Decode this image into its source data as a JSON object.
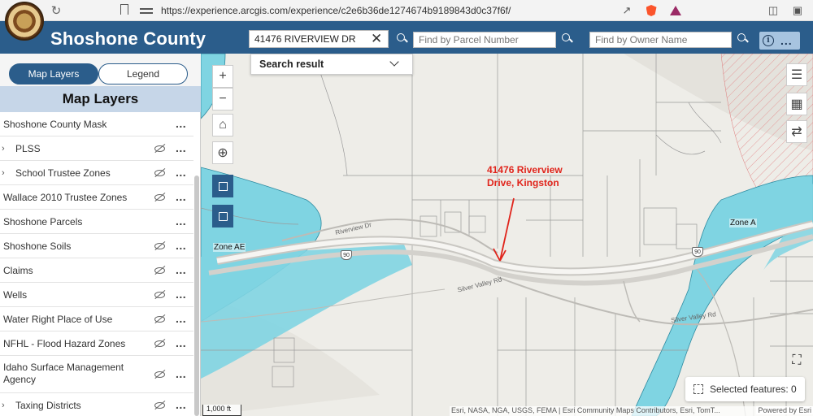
{
  "browser": {
    "url": "https://experience.arcgis.com/experience/c2e6b36de1274674b9189843d0c37f6f/"
  },
  "header": {
    "title": "Shoshone County",
    "address_value": "41476 RIVERVIEW DR",
    "parcel_placeholder": "Find by Parcel Number",
    "owner_placeholder": "Find by Owner Name",
    "search_result_label": "Search result",
    "info_label": "i",
    "more_label": "..."
  },
  "sidebar": {
    "tabs": [
      {
        "label": "Map Layers",
        "active": true
      },
      {
        "label": "Legend",
        "active": false
      }
    ],
    "panel_title": "Map Layers",
    "layers": [
      {
        "label": "Shoshone County Mask",
        "expandable": false,
        "visible_toggle": false
      },
      {
        "label": "PLSS",
        "expandable": true,
        "visible_toggle": true
      },
      {
        "label": "School Trustee Zones",
        "expandable": true,
        "visible_toggle": true
      },
      {
        "label": "Wallace 2010 Trustee Zones",
        "expandable": false,
        "visible_toggle": true
      },
      {
        "label": "Shoshone Parcels",
        "expandable": false,
        "visible_toggle": false
      },
      {
        "label": "Shoshone Soils",
        "expandable": false,
        "visible_toggle": true
      },
      {
        "label": "Claims",
        "expandable": false,
        "visible_toggle": true
      },
      {
        "label": "Wells",
        "expandable": false,
        "visible_toggle": true
      },
      {
        "label": "Water Right Place of Use",
        "expandable": false,
        "visible_toggle": true
      },
      {
        "label": "NFHL - Flood Hazard Zones",
        "expandable": false,
        "visible_toggle": true
      },
      {
        "label": "Idaho Surface Management Agency",
        "expandable": false,
        "visible_toggle": true
      },
      {
        "label": "Taxing Districts",
        "expandable": true,
        "visible_toggle": true
      }
    ],
    "more_label": "..."
  },
  "map": {
    "annotation": [
      "41476 Riverview",
      "Drive, Kingston"
    ],
    "zone_labels": [
      "Zone AE",
      "Zone A"
    ],
    "road_labels": [
      "Riverview Dr",
      "Silver Valley Rd",
      "Silver Valley Rd"
    ],
    "highway_shield": "90",
    "selected_features": "Selected features: 0",
    "attribution": "Esri, NASA, NGA, USGS, FEMA | Esri Community Maps Contributors, Esri, TomT...",
    "powered_by": "Powered by Esri",
    "scale": "1,000 ft",
    "colors": {
      "header": "#2b5d8b",
      "flood_zone": "#7fd4e2",
      "annotation": "#e0241b"
    }
  }
}
